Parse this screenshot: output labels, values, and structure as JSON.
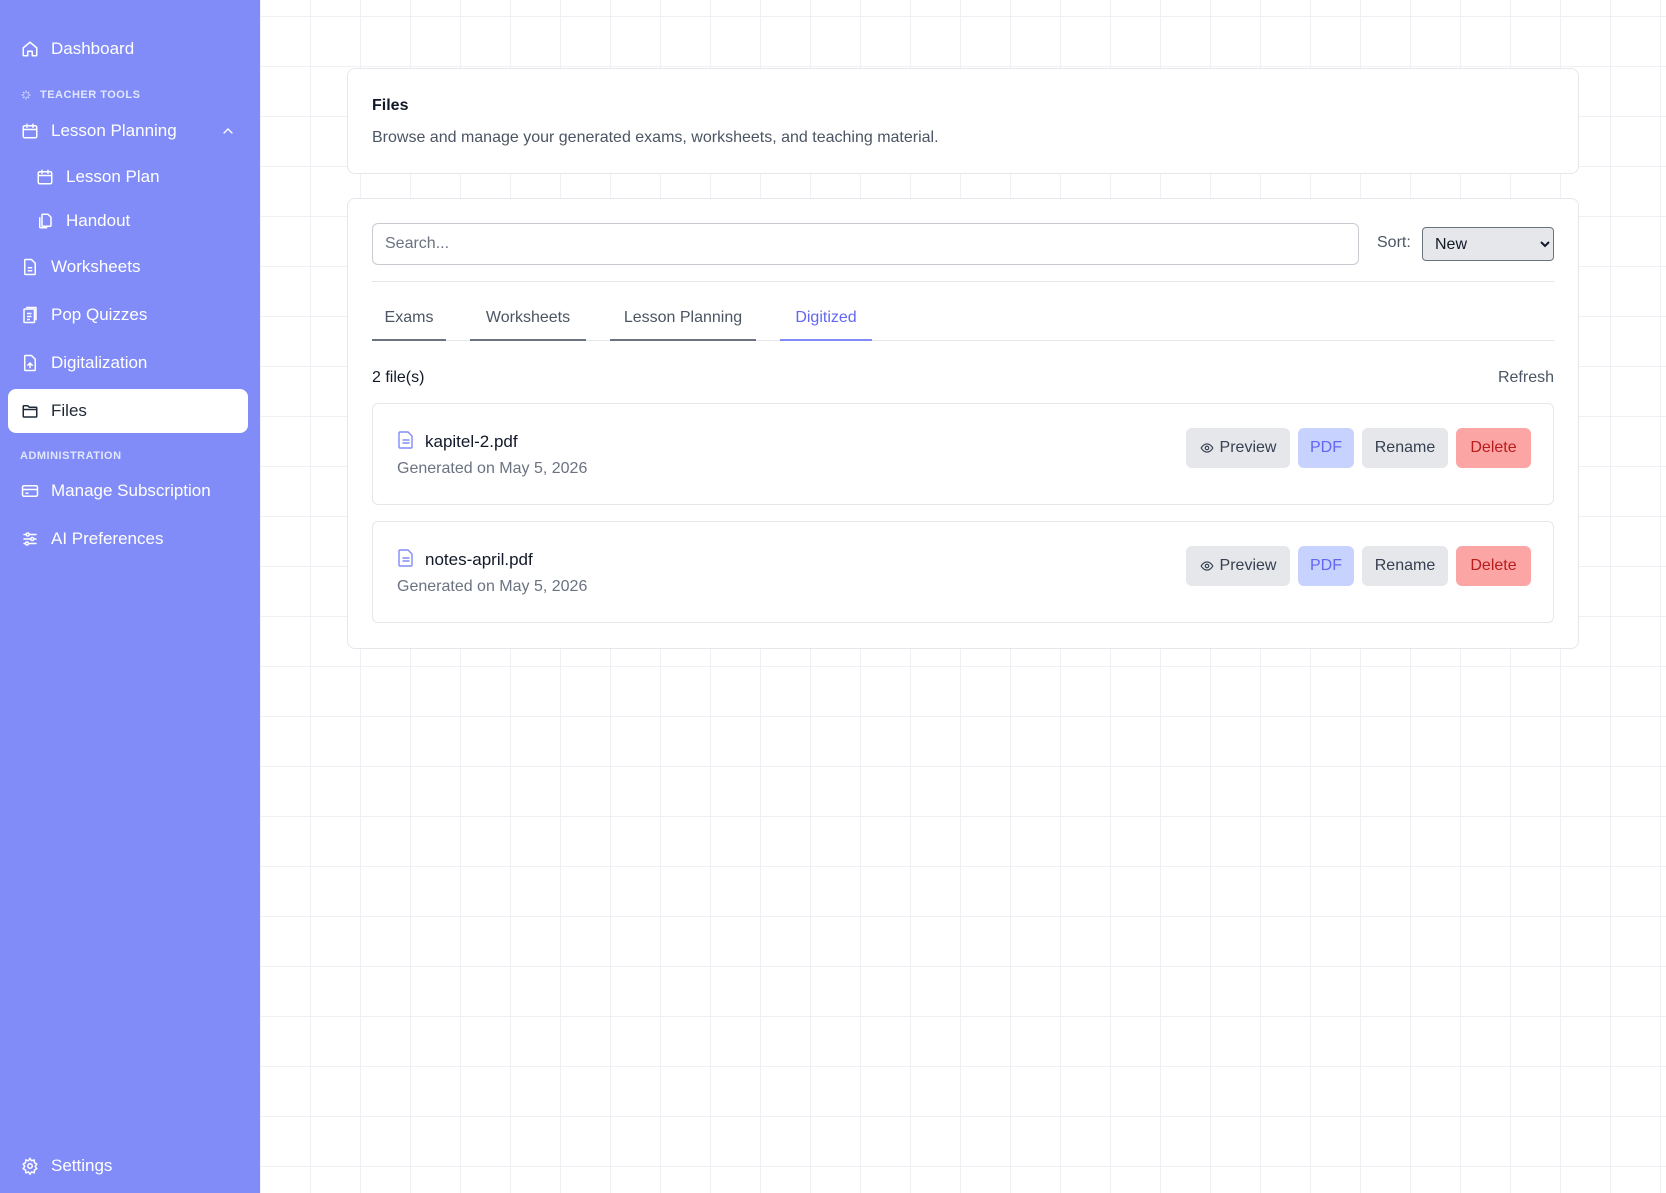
{
  "sidebar": {
    "dashboard": "Dashboard",
    "section_teacher_tools": "TEACHER TOOLS",
    "lesson_planning": "Lesson Planning",
    "lesson_plan": "Lesson Plan",
    "handout": "Handout",
    "worksheets": "Worksheets",
    "pop_quizzes": "Pop Quizzes",
    "digitalization": "Digitalization",
    "files": "Files",
    "section_administration": "ADMINISTRATION",
    "manage_subscription": "Manage Subscription",
    "ai_preferences": "AI Preferences",
    "settings": "Settings",
    "color": "#818cf8"
  },
  "header": {
    "title": "Files",
    "subtitle": "Browse and manage your generated exams, worksheets, and teaching material."
  },
  "toolbar": {
    "search_placeholder": "Search...",
    "search_value": "",
    "sort_label": "Sort:",
    "sort_selected": "New"
  },
  "tabs": [
    {
      "label": "Exams"
    },
    {
      "label": "Worksheets"
    },
    {
      "label": "Lesson Planning"
    },
    {
      "label": "Digitized",
      "active": true
    }
  ],
  "list": {
    "count": "2 file(s)",
    "refresh_label": "Refresh",
    "files": [
      {
        "name": "kapitel-2.pdf",
        "date": "Generated on May 5, 2026"
      },
      {
        "name": "notes-april.pdf",
        "date": "Generated on May 5, 2026"
      }
    ]
  },
  "actions": {
    "preview": "Preview",
    "pdf": "PDF",
    "rename": "Rename",
    "delete": "Delete"
  },
  "icons": [
    "home-icon",
    "sparkle-icon",
    "calendar-icon",
    "chevron-up-icon",
    "copy-icon",
    "document-icon",
    "quiz-icon",
    "file-upload-icon",
    "folder-icon",
    "credit-card-icon",
    "sliders-icon",
    "gear-icon",
    "eye-icon",
    "file-icon"
  ],
  "colors": {
    "accent": "#6366f1",
    "pdf_bg": "#c7d2fe",
    "delete_bg": "#fca5a5",
    "delete_text": "#b91c1c"
  }
}
